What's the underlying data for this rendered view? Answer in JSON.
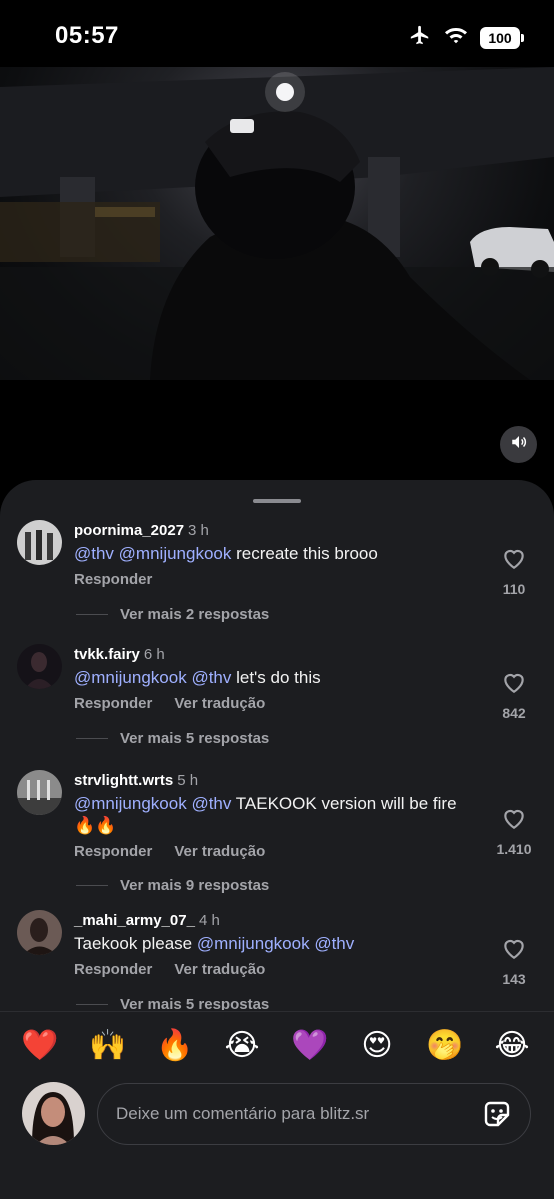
{
  "status": {
    "time": "05:57",
    "battery": "100"
  },
  "comments": [
    {
      "username": "poornima_2027",
      "time": "3 h",
      "segments": [
        {
          "text": "@thv",
          "mention": true
        },
        {
          "text": " ",
          "mention": false
        },
        {
          "text": "@mnijungkook",
          "mention": true
        },
        {
          "text": "  recreate this brooo",
          "mention": false
        }
      ],
      "reply_label": "Responder",
      "translate_label": "",
      "likes": "110",
      "more_replies": "Ver mais 2 respostas"
    },
    {
      "username": "tvkk.fairy",
      "time": "6 h",
      "segments": [
        {
          "text": "@mnijungkook",
          "mention": true
        },
        {
          "text": " ",
          "mention": false
        },
        {
          "text": "@thv",
          "mention": true
        },
        {
          "text": " let's do this",
          "mention": false
        }
      ],
      "reply_label": "Responder",
      "translate_label": "Ver tradução",
      "likes": "842",
      "more_replies": "Ver mais 5 respostas"
    },
    {
      "username": "strvlightt.wrts",
      "time": "5 h",
      "segments": [
        {
          "text": "@mnijungkook",
          "mention": true
        },
        {
          "text": " ",
          "mention": false
        },
        {
          "text": "@thv",
          "mention": true
        },
        {
          "text": " TAEKOOK version will be fire 🔥🔥",
          "mention": false
        }
      ],
      "reply_label": "Responder",
      "translate_label": "Ver tradução",
      "likes": "1.410",
      "more_replies": "Ver mais 9 respostas"
    },
    {
      "username": "_mahi_army_07_",
      "time": "4 h",
      "segments": [
        {
          "text": "Taekook please ",
          "mention": false
        },
        {
          "text": "@mnijungkook",
          "mention": true
        },
        {
          "text": " ",
          "mention": false
        },
        {
          "text": "@thv",
          "mention": true
        }
      ],
      "reply_label": "Responder",
      "translate_label": "Ver tradução",
      "likes": "143",
      "more_replies": "Ver mais 5 respostas"
    }
  ],
  "emoji_reactions": [
    {
      "emoji": "❤️",
      "name": "red-heart"
    },
    {
      "emoji": "🙌",
      "name": "raising-hands"
    },
    {
      "emoji": "🔥",
      "name": "fire"
    },
    {
      "emoji": "😭",
      "name": "loudly-crying"
    },
    {
      "emoji": "💜",
      "name": "purple-heart"
    },
    {
      "emoji": "😍",
      "name": "heart-eyes"
    },
    {
      "emoji": "🤭",
      "name": "hand-over-mouth"
    },
    {
      "emoji": "😂",
      "name": "tears-of-joy"
    }
  ],
  "composer": {
    "placeholder": "Deixe um comentário para blitz.sr"
  },
  "colors": {
    "mention": "#9fb0ff",
    "sheet_bg": "#1c1d20",
    "muted_text": "#a3a4a9"
  },
  "icons": {
    "airplane": "airplane-mode-icon",
    "wifi": "wifi-icon",
    "sound": "speaker-icon",
    "like": "heart-outline-icon",
    "sticker": "sticker-icon"
  }
}
